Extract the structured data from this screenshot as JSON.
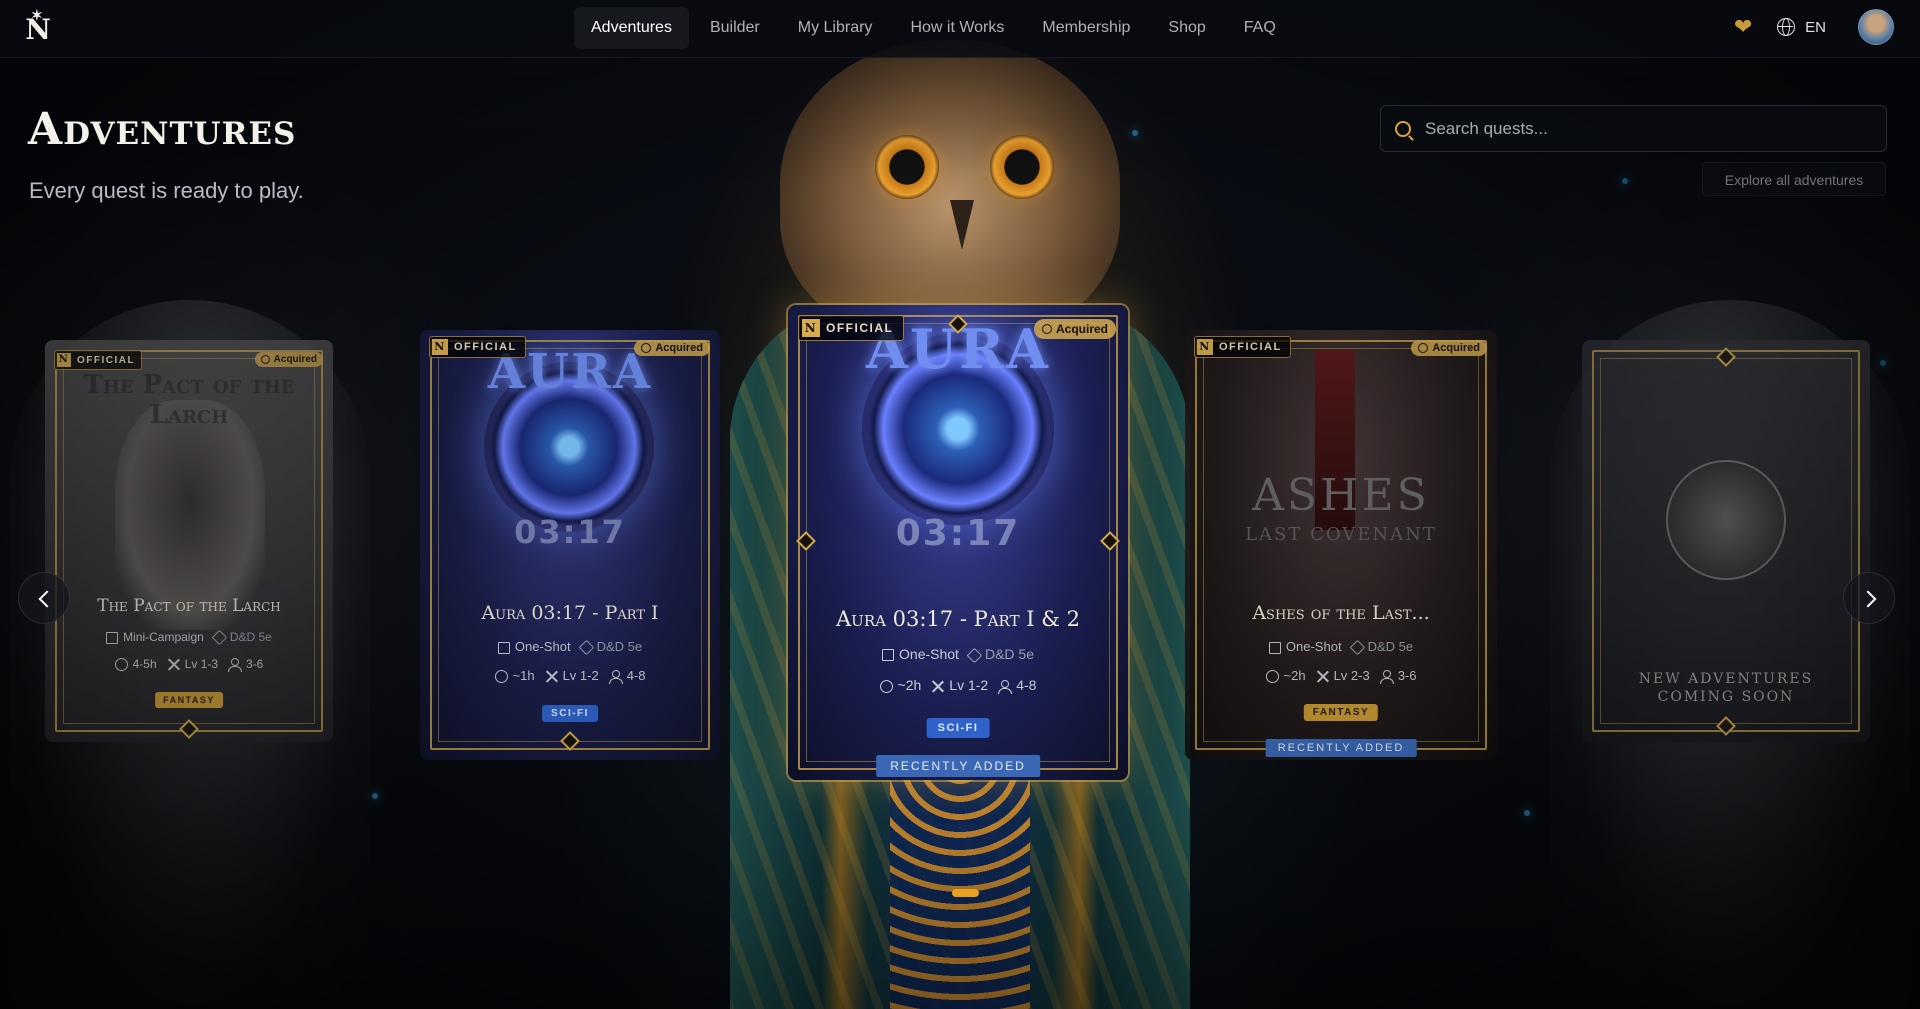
{
  "nav": {
    "logo": "N",
    "links": [
      "Adventures",
      "Builder",
      "My Library",
      "How it Works",
      "Membership",
      "Shop",
      "FAQ"
    ],
    "active": "Adventures",
    "language": "EN"
  },
  "hero": {
    "title": "Adventures",
    "subtitle": "Every quest is ready to play.",
    "search_placeholder": "Search quests...",
    "explore_label": "Explore all adventures"
  },
  "carousel": {
    "cards": [
      {
        "badge": "OFFICIAL",
        "acquired": "Acquired",
        "art_text": "The Pact of the Larch",
        "title": "The Pact of the Larch",
        "format": "Mini-Campaign",
        "system": "D&D 5e",
        "duration": "4-5h",
        "level": "Lv 1-3",
        "players": "3-6",
        "genre": "FANTASY"
      },
      {
        "badge": "OFFICIAL",
        "acquired": "Acquired",
        "art_text": "AURA",
        "art_time": "03:17",
        "title": "Aura 03:17 - Part I",
        "format": "One-Shot",
        "system": "D&D 5e",
        "duration": "~1h",
        "level": "Lv 1-2",
        "players": "4-8",
        "genre": "SCI-FI"
      },
      {
        "badge": "OFFICIAL",
        "acquired": "Acquired",
        "art_text": "AURA",
        "art_time": "03:17",
        "title": "Aura 03:17 - Part I & 2",
        "format": "One-Shot",
        "system": "D&D 5e",
        "duration": "~2h",
        "level": "Lv 1-2",
        "players": "4-8",
        "genre": "SCI-FI",
        "recent": "RECENTLY ADDED"
      },
      {
        "badge": "OFFICIAL",
        "acquired": "Acquired",
        "art_text": "ASHES",
        "art_sub": "LAST COVENANT",
        "title": "Ashes of the Last...",
        "format": "One-Shot",
        "system": "D&D 5e",
        "duration": "~2h",
        "level": "Lv 2-3",
        "players": "3-6",
        "genre": "FANTASY",
        "recent": "RECENTLY ADDED"
      },
      {
        "coming_soon": "NEW ADVENTURES COMING SOON"
      }
    ],
    "active_index": 2
  },
  "colors": {
    "gold": "#d6ac4e",
    "accent": "#e8a021",
    "scifi": "#2f63c9",
    "recent": "#3a68b5"
  },
  "icons": [
    "search-icon",
    "heart-icon",
    "globe-icon",
    "chevron-left-icon",
    "chevron-right-icon",
    "book-icon",
    "tag-icon",
    "clock-icon",
    "swords-icon",
    "users-icon",
    "check-icon"
  ]
}
